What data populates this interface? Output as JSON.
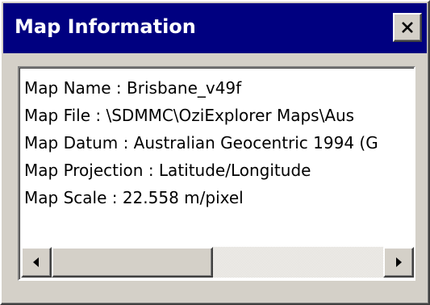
{
  "window": {
    "title": "Map Information",
    "close_label": "×",
    "title_bar_color": "#000080"
  },
  "info": {
    "lines": [
      "Map Name : Brisbane_v49f",
      "Map File : \\SDMMC\\OziExplorer Maps\\Aus",
      "Map Datum : Australian Geocentric 1994 (G",
      "Map Projection : Latitude/Longitude",
      "Map Scale : 22.558 m/pixel"
    ]
  },
  "scrollbar": {
    "left_icon": "arrow-left-icon",
    "right_icon": "arrow-right-icon"
  }
}
